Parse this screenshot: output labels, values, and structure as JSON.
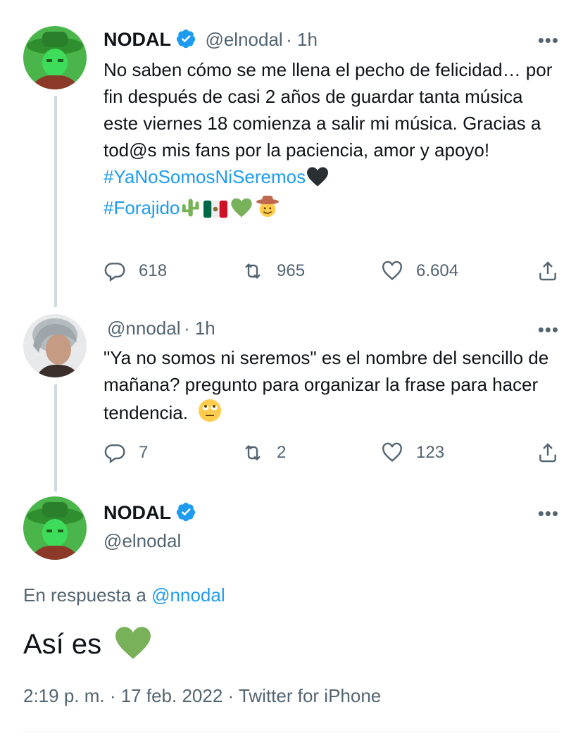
{
  "tweets": [
    {
      "name": "NODAL",
      "handle": "@elnodal",
      "time": "· 1h",
      "text": "No saben cómo se me llena el pecho de felicidad… por fin después de casi 2 años de guardar tanta música este viernes 18 comienza a salir mi música. Gracias a tod@s mis fans por la paciencia, amor y apoyo!",
      "hashtags": [
        "#YaNoSomosNiSeremos",
        "#Forajido"
      ],
      "replies": "618",
      "retweets": "965",
      "likes": "6.604"
    },
    {
      "handle": "@nnodal",
      "time": "· 1h",
      "text": "\"Ya no somos ni seremos\" es el nombre del sencillo de mañana? pregunto para organizar la frase para hacer tendencia.",
      "replies": "7",
      "retweets": "2",
      "likes": "123"
    }
  ],
  "main": {
    "name": "NODAL",
    "handle": "@elnodal",
    "reply_prefix": "En respuesta a",
    "reply_to": "@nnodal",
    "text": "Así es",
    "timestamp": "2:19 p. m. · 17 feb. 2022 · ",
    "source": "Twitter for iPhone"
  },
  "icons": {
    "more": "•••",
    "verified": "verified-badge-icon",
    "reply": "reply-icon",
    "retweet": "retweet-icon",
    "like": "heart-icon",
    "share": "share-icon"
  },
  "colors": {
    "accent": "#1d9bf0",
    "secondary_text": "#536471",
    "avatar_green": "#3ddc5a"
  }
}
